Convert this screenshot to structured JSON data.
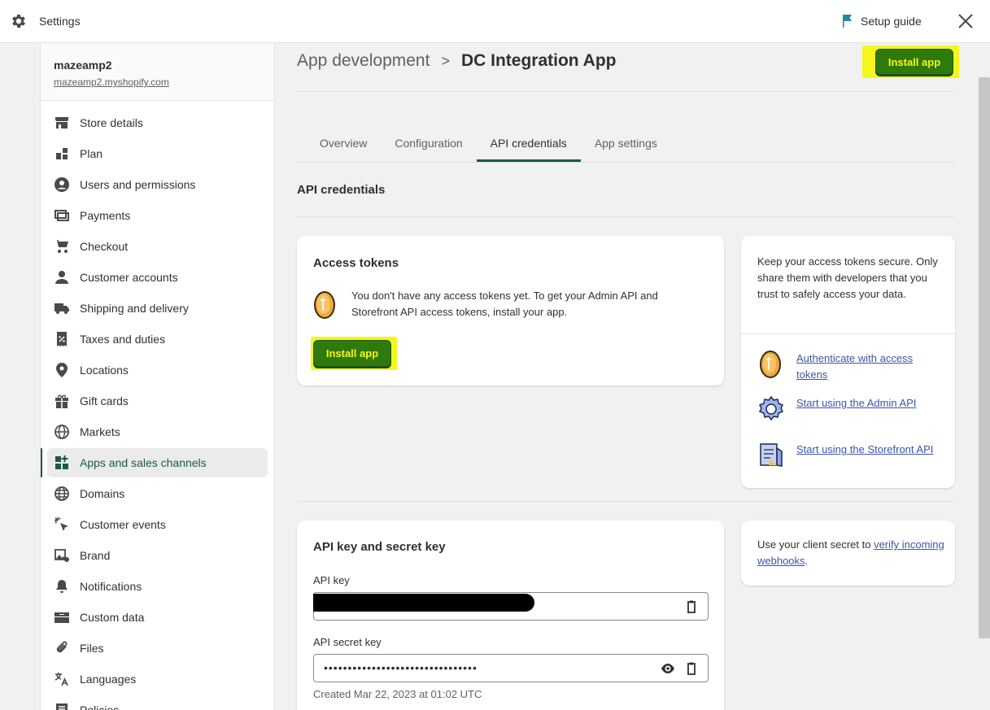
{
  "header": {
    "title": "Settings",
    "setup_guide": "Setup guide"
  },
  "sidebar": {
    "store_name": "mazeamp2",
    "store_url": "mazeamp2.myshopify.com",
    "items": [
      {
        "label": "Store details"
      },
      {
        "label": "Plan"
      },
      {
        "label": "Users and permissions"
      },
      {
        "label": "Payments"
      },
      {
        "label": "Checkout"
      },
      {
        "label": "Customer accounts"
      },
      {
        "label": "Shipping and delivery"
      },
      {
        "label": "Taxes and duties"
      },
      {
        "label": "Locations"
      },
      {
        "label": "Gift cards"
      },
      {
        "label": "Markets"
      },
      {
        "label": "Apps and sales channels"
      },
      {
        "label": "Domains"
      },
      {
        "label": "Customer events"
      },
      {
        "label": "Brand"
      },
      {
        "label": "Notifications"
      },
      {
        "label": "Custom data"
      },
      {
        "label": "Files"
      },
      {
        "label": "Languages"
      },
      {
        "label": "Policies"
      }
    ],
    "active_index": 11
  },
  "breadcrumb": {
    "parent": "App development",
    "separator": ">",
    "current": "DC Integration App"
  },
  "install_button": "Install app",
  "tabs": [
    {
      "label": "Overview"
    },
    {
      "label": "Configuration"
    },
    {
      "label": "API credentials"
    },
    {
      "label": "App settings"
    }
  ],
  "active_tab": 2,
  "section_title": "API credentials",
  "access_tokens": {
    "title": "Access tokens",
    "message": "You don't have any access tokens yet. To get your Admin API and Storefront API access tokens, install your app.",
    "button": "Install app"
  },
  "tips": {
    "text": "Keep your access tokens secure. Only share them with developers that you trust to safely access your data.",
    "links": [
      {
        "label": "Authenticate with access tokens",
        "icon": "coin-icon"
      },
      {
        "label": "Start using the Admin API",
        "icon": "gear-cog-icon"
      },
      {
        "label": "Start using the Storefront API",
        "icon": "storefront-blueprint-icon"
      }
    ]
  },
  "keys": {
    "title": "API key and secret key",
    "api_key_label": "API key",
    "api_secret_label": "API secret key",
    "api_secret_masked": "••••••••••••••••••••••••••••••••",
    "created": "Created Mar 22, 2023 at 01:02 UTC"
  },
  "webhook": {
    "prefix": "Use your client secret to ",
    "link": "verify incoming webhooks",
    "suffix": "."
  },
  "colors": {
    "install_bg": "#2e7a0c",
    "install_text": "#f6f61f",
    "highlight": "#f6f61f",
    "active_accent": "#1a5c3a",
    "link": "#3b56a8"
  }
}
